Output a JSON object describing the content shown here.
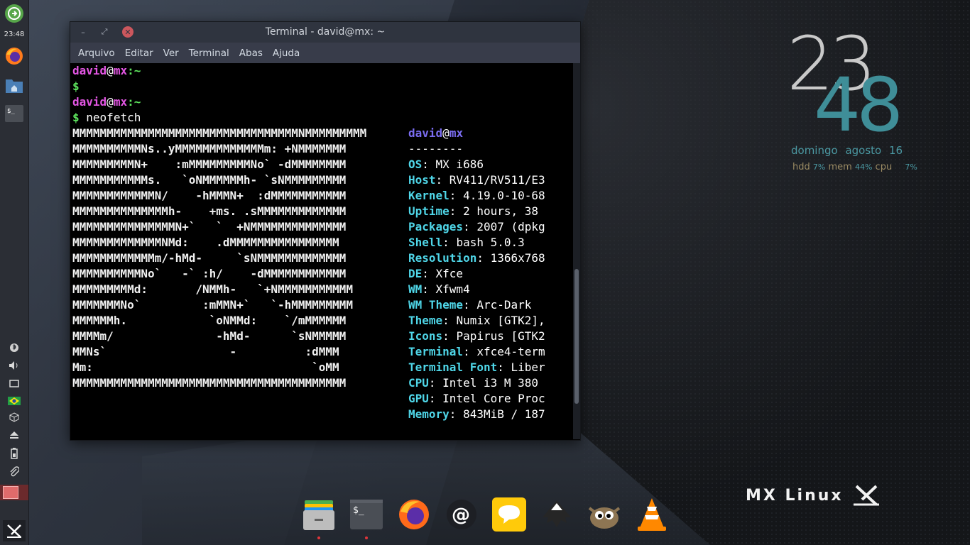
{
  "panel": {
    "clock": "23:48",
    "launchers": [
      "firefox-icon",
      "file-manager-icon",
      "terminal-icon"
    ],
    "tray": [
      "bluetooth-icon",
      "volume-icon",
      "display-icon",
      "brazil-flag-icon",
      "package-icon",
      "eject-icon",
      "battery-icon",
      "clip-icon"
    ],
    "accent_color": "#cc575d"
  },
  "window": {
    "title": "Terminal - david@mx: ~",
    "menu": [
      "Arquivo",
      "Editar",
      "Ver",
      "Terminal",
      "Abas",
      "Ajuda"
    ]
  },
  "terminal": {
    "prompt_user": "david",
    "prompt_at": "@",
    "prompt_host": "mx",
    "prompt_path": ":~",
    "prompt_symbol": "$",
    "command": "neofetch",
    "ascii_art": [
      "MMMMMMMMMMMMMMMMMMMMMMMMMMMMMMMMMNMMMMMMMMM",
      "MMMMMMMMMMNs..yMMMMMMMMMMMMMm: +NMMMMMMM",
      "MMMMMMMMMN+    :mMMMMMMMMMNo` -dMMMMMMMM",
      "MMMMMMMMMMMs.   `oNMMMMMMh- `sNMMMMMMMMM",
      "MMMMMMMMMMMMN/    -hMMMN+  :dMMMMMMMMMMM",
      "MMMMMMMMMMMMMMh-    +ms. .sMMMMMMMMMMMMM",
      "MMMMMMMMMMMMMMMN+`   `  +NMMMMMMMMMMMMMM",
      "MMMMMMMMMMMMMNMd:    .dMMMMMMMMMMMMMMMM",
      "MMMMMMMMMMMMm/-hMd-     `sNMMMMMMMMMMMMM",
      "MMMMMMMMMMNo`   -` :h/    -dMMMMMMMMMMMM",
      "MMMMMMMMMd:       /NMMh-   `+NMMMMMMMMMMM",
      "MMMMMMMNo`         :mMMN+`   `-hMMMMMMMMM",
      "MMMMMMh.            `oNMMd:    `/mMMMMMM",
      "MMMMm/               -hMd-      `sNMMMMM",
      "MMNs`                  -          :dMMM",
      "Mm:                                `oMM",
      "MMMMMMMMMMMMMMMMMMMMMMMMMMMMMMMMMMMMMMMM"
    ],
    "info_user": "david",
    "info_at": "@",
    "info_host": "mx",
    "separator": "--------",
    "info": [
      {
        "key": "OS",
        "value": ": MX i686"
      },
      {
        "key": "Host",
        "value": ": RV411/RV511/E3"
      },
      {
        "key": "Kernel",
        "value": ": 4.19.0-10-68"
      },
      {
        "key": "Uptime",
        "value": ": 2 hours, 38"
      },
      {
        "key": "Packages",
        "value": ": 2007 (dpkg"
      },
      {
        "key": "Shell",
        "value": ": bash 5.0.3"
      },
      {
        "key": "Resolution",
        "value": ": 1366x768"
      },
      {
        "key": "DE",
        "value": ": Xfce"
      },
      {
        "key": "WM",
        "value": ": Xfwm4"
      },
      {
        "key": "WM Theme",
        "value": ": Arc-Dark"
      },
      {
        "key": "Theme",
        "value": ": Numix [GTK2],"
      },
      {
        "key": "Icons",
        "value": ": Papirus [GTK2"
      },
      {
        "key": "Terminal",
        "value": ": xfce4-term"
      },
      {
        "key": "Terminal Font",
        "value": ": Liber"
      },
      {
        "key": "CPU",
        "value": ": Intel i3 M 380"
      },
      {
        "key": "GPU",
        "value": ": Intel Core Proc"
      },
      {
        "key": "Memory",
        "value": ": 843MiB / 187"
      }
    ]
  },
  "conky": {
    "hour": "23",
    "minute": "48",
    "date": "domingo  agosto 16",
    "hdd_label": "hdd",
    "hdd_pct": "7%",
    "mem_label": "mem",
    "mem_pct": "44%",
    "cpu_label": "cpu",
    "cpu_pct": "7%"
  },
  "brand": {
    "text": "MX Linux"
  },
  "dock": [
    "files-icon",
    "terminal-icon",
    "firefox-icon",
    "email-icon",
    "chat-icon",
    "inkscape-icon",
    "gimp-icon",
    "vlc-icon"
  ]
}
